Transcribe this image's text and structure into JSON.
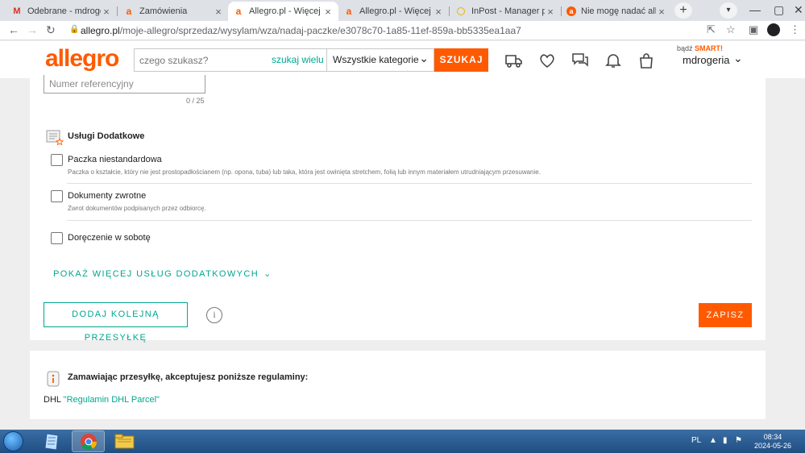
{
  "browser": {
    "tabs": [
      {
        "title": "Odebrane - mdrogeria",
        "favicon": "gmail-icon"
      },
      {
        "title": "Zamówienia",
        "favicon": "allegro-icon"
      },
      {
        "title": "Allegro.pl - Więcej niż aukcje",
        "favicon": "allegro-icon",
        "active": true
      },
      {
        "title": "Allegro.pl - Więcej niż aukcje",
        "favicon": "allegro-icon"
      },
      {
        "title": "InPost - Manager paczek",
        "favicon": "inpost-icon"
      },
      {
        "title": "Nie mogę nadać allegro",
        "favicon": "allegro-round-icon"
      }
    ],
    "new_tab": "+",
    "url_host": "allegro.pl",
    "url_path": "/moje-allegro/sprzedaz/wysylam/wza/nadaj-paczke/e3078c70-1a85-11ef-859a-bb5335ea1aa7"
  },
  "header": {
    "logo": "allegro",
    "search_placeholder": "czego szukasz?",
    "search_many": "szukaj wielu",
    "category": "Wszystkie kategorie",
    "search_button": "SZUKAJ",
    "smart_prefix": "bądź",
    "smart_label": "SMART!",
    "username": "mdrogeria"
  },
  "form": {
    "reference_placeholder": "Numer referencyjny",
    "reference_counter": "0 / 25",
    "services_title": "Usługi Dodatkowe",
    "options": [
      {
        "label": "Paczka niestandardowa",
        "description": "Paczka o kształcie, który nie jest prostopadłościanem (np. opona, tuba) lub taka, która jest owinięta stretchem, folią lub innym materiałem utrudniającym przesuwanie.",
        "checked": false
      },
      {
        "label": "Dokumenty zwrotne",
        "description": "Zwrot dokumentów podpisanych przez odbiorcę.",
        "checked": false
      },
      {
        "label": "Doręczenie w sobotę",
        "description": "",
        "checked": false
      }
    ],
    "show_more": "POKAŻ WIĘCEJ USŁUG DODATKOWYCH",
    "add_shipment": "DODAJ KOLEJNĄ PRZESYŁKĘ",
    "info": "i",
    "save": "ZAPISZ"
  },
  "regulations": {
    "title": "Zamawiając przesyłkę, akceptujesz poniższe regulaminy:",
    "carrier": "DHL",
    "link": "\"Regulamin DHL Parcel\""
  },
  "taskbar": {
    "language": "PL",
    "time": "08:34",
    "date": "2024-05-26"
  },
  "colors": {
    "brand": "#ff5a00",
    "accent": "#00a790"
  }
}
